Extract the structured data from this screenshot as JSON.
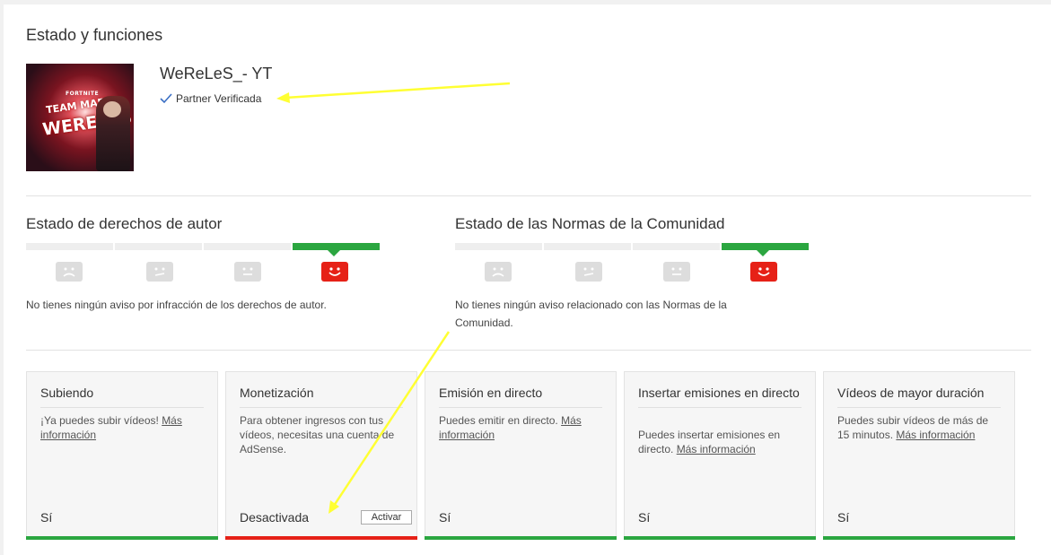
{
  "page": {
    "title": "Estado y funciones"
  },
  "channel": {
    "name": "WeReLeS_- YT",
    "partner_status": "Partner Verificada",
    "avatar_text_small": "FORTNITE",
    "avatar_text_team": "TEAM MAFIA",
    "avatar_text_main": "WERELES"
  },
  "copyright": {
    "title": "Estado de derechos de autor",
    "description": "No tienes ningún aviso por infracción de los derechos de autor.",
    "active_segment": 4
  },
  "community": {
    "title": "Estado de las Normas de la Comunidad",
    "description_line1": "No tienes ningún aviso relacionado con las Normas de la",
    "description_line2": "Comunidad.",
    "active_segment": 4
  },
  "cards": [
    {
      "title": "Subiendo",
      "body": "¡Ya puedes subir vídeos! ",
      "link": "Más información",
      "status": "Sí"
    },
    {
      "title": "Monetización",
      "body": "Para obtener ingresos con tus vídeos, necesitas una cuenta de AdSense.",
      "link": "",
      "status": "Desactivada",
      "button": "Activar"
    },
    {
      "title": "Emisión en directo",
      "body": "Puedes emitir en directo. ",
      "link": "Más información",
      "status": "Sí"
    },
    {
      "title": "Insertar emisiones en directo",
      "body": "Puedes insertar emisiones en directo. ",
      "link": "Más información",
      "status": "Sí"
    },
    {
      "title": "Vídeos de mayor duración",
      "body": "Puedes subir vídeos de más de 15 minutos. ",
      "link": "Más información",
      "status": "Sí"
    }
  ],
  "colors": {
    "good": "#2ba640",
    "bad": "#e62117",
    "annotation": "#ffff33"
  }
}
